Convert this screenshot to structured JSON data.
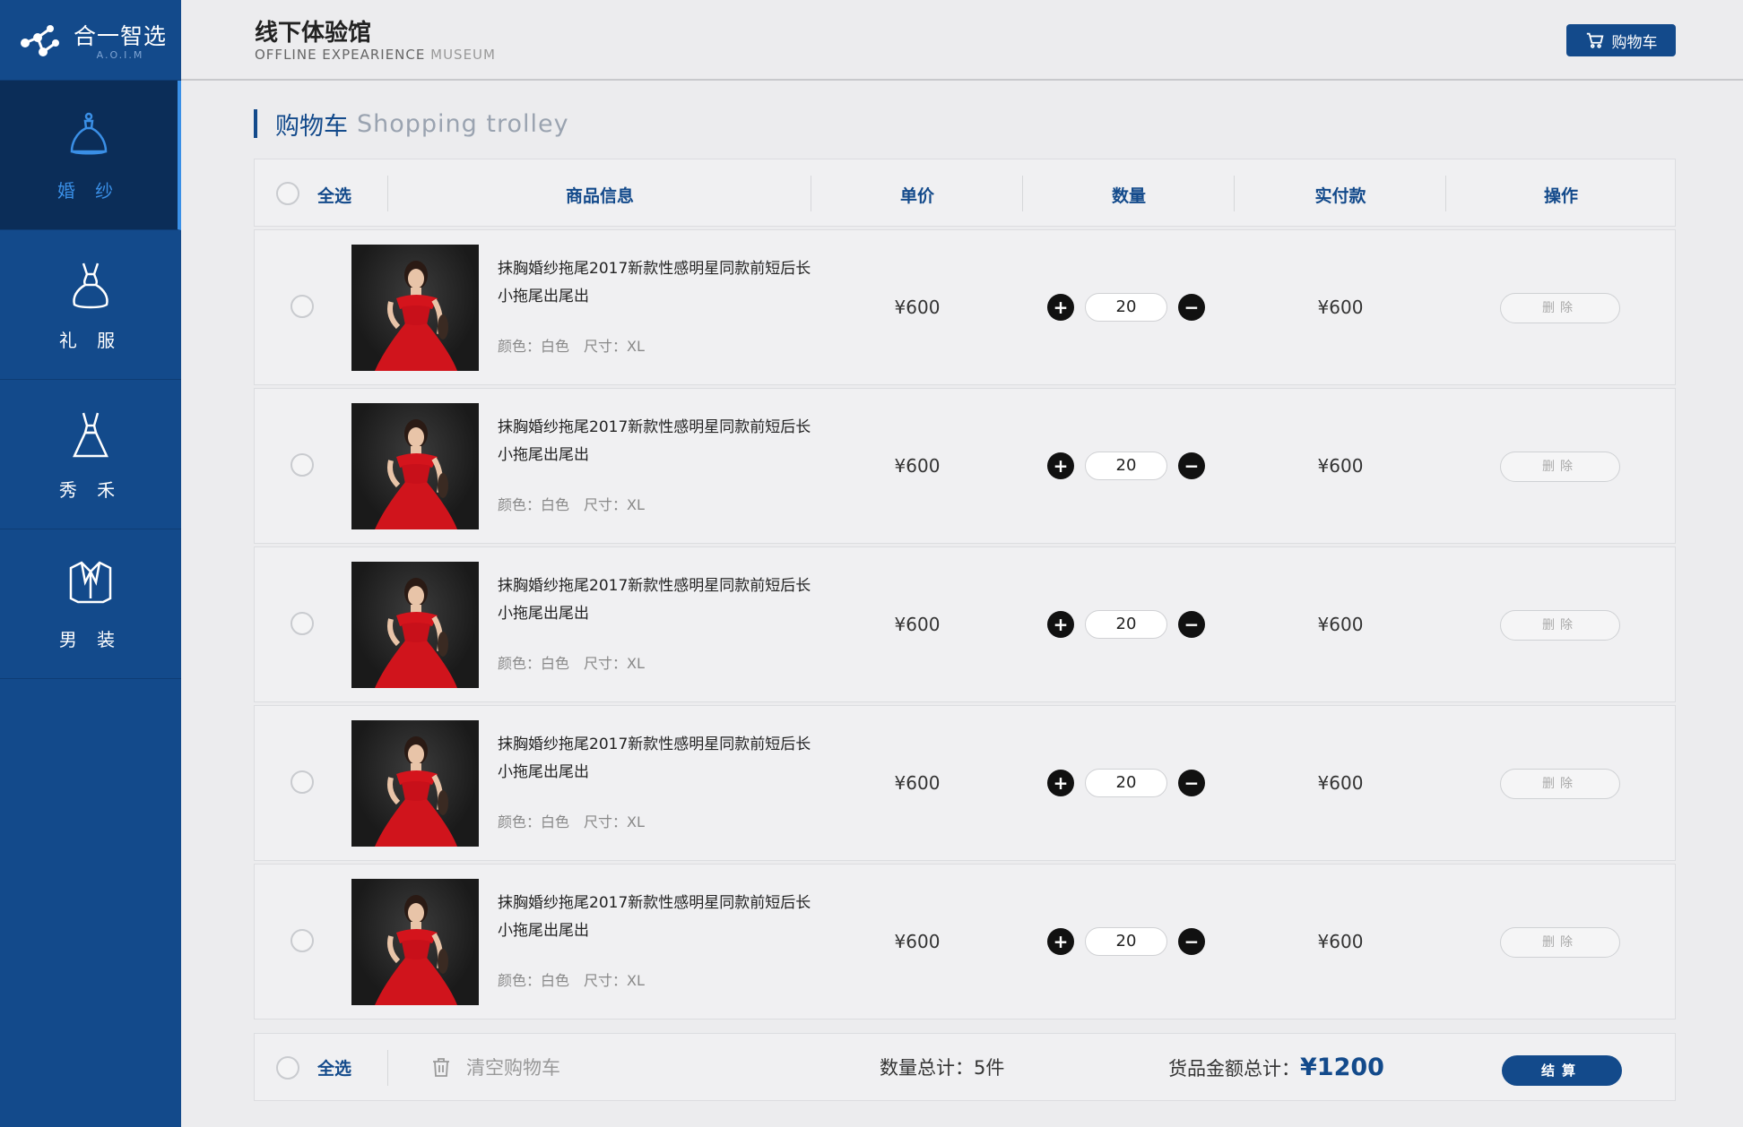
{
  "app": {
    "logo_name": "合一智选",
    "logo_sub": "A.O.I.M"
  },
  "sidebar": {
    "items": [
      {
        "label": "婚 纱",
        "icon": "wedding-dress-icon"
      },
      {
        "label": "礼 服",
        "icon": "gown-icon"
      },
      {
        "label": "秀 禾",
        "icon": "xiuhe-dress-icon"
      },
      {
        "label": "男 装",
        "icon": "suit-icon"
      }
    ]
  },
  "header": {
    "title": "线下体验馆",
    "subtitle_dark": "OFFLINE EXPEARIENCE",
    "subtitle_light": "MUSEUM",
    "cart_label": "购物车"
  },
  "section": {
    "title": "购物车",
    "title_en": "Shopping trolley"
  },
  "table": {
    "select_all": "全选",
    "headers": [
      "商品信息",
      "单价",
      "数量",
      "实付款",
      "操作"
    ],
    "rows": [
      {
        "name": "抹胸婚纱拖尾2017新款性感明星同款前短后长小拖尾出尾出",
        "spec": "颜色：白色　尺寸：XL",
        "price": "¥600",
        "qty": "20",
        "total": "¥600",
        "delete_label": "删除"
      },
      {
        "name": "抹胸婚纱拖尾2017新款性感明星同款前短后长小拖尾出尾出",
        "spec": "颜色：白色　尺寸：XL",
        "price": "¥600",
        "qty": "20",
        "total": "¥600",
        "delete_label": "删除"
      },
      {
        "name": "抹胸婚纱拖尾2017新款性感明星同款前短后长小拖尾出尾出",
        "spec": "颜色：白色　尺寸：XL",
        "price": "¥600",
        "qty": "20",
        "total": "¥600",
        "delete_label": "删除"
      },
      {
        "name": "抹胸婚纱拖尾2017新款性感明星同款前短后长小拖尾出尾出",
        "spec": "颜色：白色　尺寸：XL",
        "price": "¥600",
        "qty": "20",
        "total": "¥600",
        "delete_label": "删除"
      },
      {
        "name": "抹胸婚纱拖尾2017新款性感明星同款前短后长小拖尾出尾出",
        "spec": "颜色：白色　尺寸：XL",
        "price": "¥600",
        "qty": "20",
        "total": "¥600",
        "delete_label": "删除"
      }
    ]
  },
  "footer": {
    "select_all": "全选",
    "clear_cart": "清空购物车",
    "qty_label": "数量总计：",
    "qty_value": "5件",
    "amount_label": "货品金额总计：",
    "amount_value": "¥1200",
    "checkout_label": "结算"
  },
  "colors": {
    "primary": "#134a8b",
    "active_accent": "#3a8fe6",
    "background": "#ececee"
  }
}
